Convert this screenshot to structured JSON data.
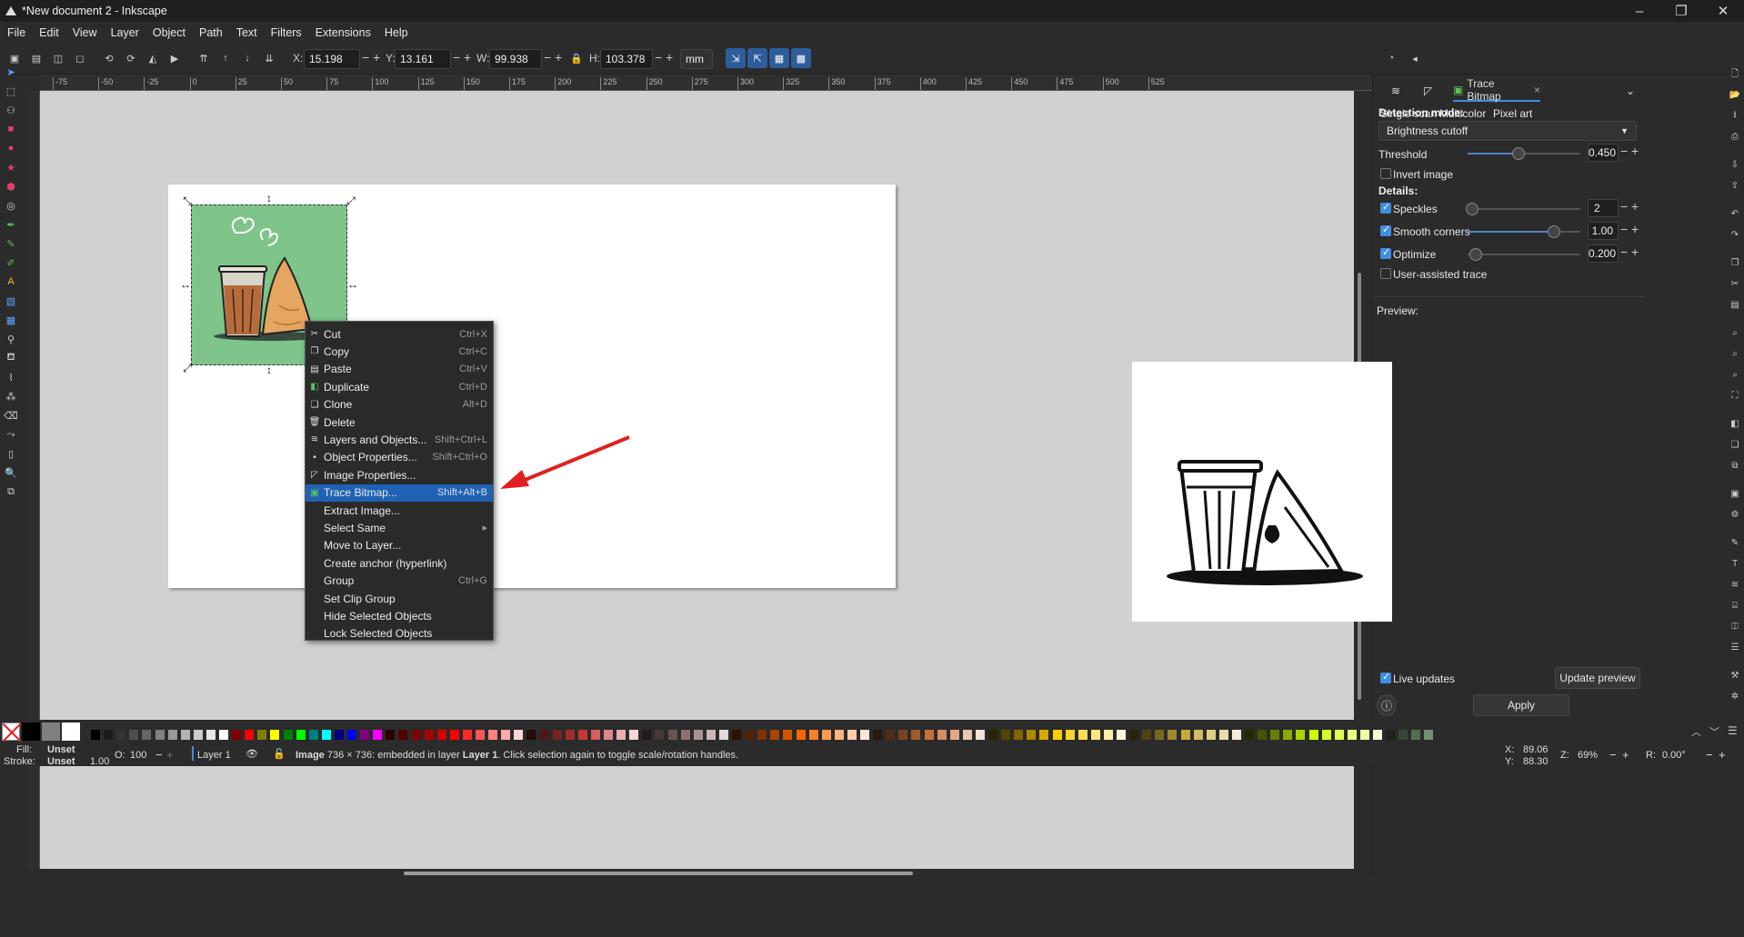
{
  "window": {
    "title": "*New document 2 - Inkscape",
    "minimize": "–",
    "maximize": "❐",
    "close": "✕"
  },
  "menu": [
    "File",
    "Edit",
    "View",
    "Layer",
    "Object",
    "Path",
    "Text",
    "Filters",
    "Extensions",
    "Help"
  ],
  "toolbar": {
    "x_label": "X:",
    "x_value": "15.198",
    "y_label": "Y:",
    "y_value": "13.161",
    "w_label": "W:",
    "w_value": "99.938",
    "h_label": "H:",
    "h_value": "103.378",
    "unit": "mm"
  },
  "ruler_ticks": [
    "-75",
    "-50",
    "-25",
    "0",
    "25",
    "50",
    "75",
    "100",
    "125",
    "150",
    "175",
    "200",
    "225",
    "250",
    "275",
    "300",
    "325",
    "350",
    "375",
    "400",
    "425",
    "450",
    "475",
    "500",
    "525"
  ],
  "context_menu": [
    {
      "icon": "scissors-icon",
      "glyph": "✂",
      "label": "Cut",
      "shortcut": "Ctrl+X"
    },
    {
      "icon": "copy-icon",
      "glyph": "❐",
      "label": "Copy",
      "shortcut": "Ctrl+C"
    },
    {
      "icon": "paste-icon",
      "glyph": "▤",
      "label": "Paste",
      "shortcut": "Ctrl+V"
    },
    {
      "icon": "duplicate-icon",
      "glyph": "◧",
      "label": "Duplicate",
      "shortcut": "Ctrl+D"
    },
    {
      "icon": "clone-icon",
      "glyph": "❏",
      "label": "Clone",
      "shortcut": "Alt+D"
    },
    {
      "icon": "trash-icon",
      "glyph": "🗑",
      "label": "Delete",
      "shortcut": ""
    },
    {
      "icon": "layers-icon",
      "glyph": "≋",
      "label": "Layers and Objects...",
      "shortcut": "Shift+Ctrl+L"
    },
    {
      "icon": "object-properties-icon",
      "glyph": "▪",
      "label": "Object Properties...",
      "shortcut": "Shift+Ctrl+O"
    },
    {
      "icon": "image-properties-icon",
      "glyph": "◸",
      "label": "Image Properties...",
      "shortcut": ""
    },
    {
      "icon": "trace-bitmap-icon",
      "glyph": "▣",
      "label": "Trace Bitmap...",
      "shortcut": "Shift+Alt+B"
    },
    {
      "icon": "",
      "glyph": "",
      "label": "Extract Image...",
      "shortcut": ""
    },
    {
      "icon": "",
      "glyph": "",
      "label": "Select Same",
      "shortcut": "▸"
    },
    {
      "icon": "",
      "glyph": "",
      "label": "Move to Layer...",
      "shortcut": ""
    },
    {
      "icon": "",
      "glyph": "",
      "label": "Create anchor (hyperlink)",
      "shortcut": ""
    },
    {
      "icon": "",
      "glyph": "",
      "label": "Group",
      "shortcut": "Ctrl+G"
    },
    {
      "icon": "",
      "glyph": "",
      "label": "Set Clip Group",
      "shortcut": ""
    },
    {
      "icon": "",
      "glyph": "",
      "label": "Hide Selected Objects",
      "shortcut": ""
    },
    {
      "icon": "",
      "glyph": "",
      "label": "Lock Selected Objects",
      "shortcut": ""
    }
  ],
  "panel": {
    "tab_label": "Trace Bitmap",
    "tab_close": "×",
    "subtabs": [
      "Single scan",
      "Multicolor",
      "Pixel art"
    ],
    "detection_mode_label": "Detection mode:",
    "detection_mode_value": "Brightness cutoff",
    "threshold_label": "Threshold",
    "threshold_value": "0.450",
    "threshold_level": 0.45,
    "invert_label": "Invert image",
    "invert_checked": false,
    "details_label": "Details:",
    "speckles_label": "Speckles",
    "speckles_value": "2",
    "speckles_checked": true,
    "smooth_label": "Smooth corners",
    "smooth_value": "1.00",
    "smooth_checked": true,
    "optimize_label": "Optimize",
    "optimize_value": "0.200",
    "optimize_checked": true,
    "user_assisted_label": "User-assisted trace",
    "user_assisted_checked": false,
    "preview_label": "Preview:",
    "live_updates_label": "Live updates",
    "live_updates_checked": true,
    "update_preview_label": "Update preview",
    "apply_label": "Apply"
  },
  "status": {
    "fill_label": "Fill:",
    "fill_value": "Unset",
    "stroke_label": "Stroke:",
    "stroke_value": "Unset",
    "stroke_width": "1.00",
    "opacity_label": "O:",
    "opacity_value": "100",
    "layer_value": "Layer 1",
    "message_bold": "Image",
    "message": "736 × 736: embedded in layer",
    "message_layer": "Layer 1",
    "message_tail": ". Click selection again to toggle scale/rotation handles.",
    "x_label": "X:",
    "x_value": "89.06",
    "y_label": "Y:",
    "y_value": "88.30",
    "zoom_label": "Z:",
    "zoom_value": "69%",
    "rotation_label": "R:",
    "rotation_value": "0.00°"
  },
  "colors": {
    "accent": "#1f62b3",
    "checkbox": "#3f8de4",
    "image_bg": "#7ec48b",
    "arrow": "#e02020"
  },
  "palette": [
    "#000000",
    "#1a1a1a",
    "#333333",
    "#4d4d4d",
    "#666666",
    "#808080",
    "#999999",
    "#b3b3b3",
    "#cccccc",
    "#e6e6e6",
    "#ffffff",
    "#800000",
    "#ff0000",
    "#808000",
    "#ffff00",
    "#008000",
    "#00ff00",
    "#008080",
    "#00ffff",
    "#000080",
    "#0000ff",
    "#800080",
    "#ff00ff",
    "#2b0000",
    "#550000",
    "#800000",
    "#aa0000",
    "#d40000",
    "#ff0000",
    "#ff2a2a",
    "#ff5555",
    "#ff8080",
    "#ffaaaa",
    "#ffd5d5",
    "#280b0b",
    "#501616",
    "#782121",
    "#a02c2c",
    "#c83737",
    "#d35f5f",
    "#de8787",
    "#e9afaf",
    "#f4d7d7",
    "#241c1c",
    "#483737",
    "#6c5353",
    "#916f6f",
    "#ac9393",
    "#c8b7b7",
    "#e3dbdb",
    "#2b1100",
    "#552200",
    "#803300",
    "#aa4400",
    "#d45500",
    "#ff6600",
    "#ff7f2a",
    "#ff9955",
    "#ffb380",
    "#ffccaa",
    "#ffe6d5",
    "#28170b",
    "#502d16",
    "#784421",
    "#a05a2c",
    "#c87137",
    "#d38d5f",
    "#deaa87",
    "#e9c6af",
    "#f4e3d7",
    "#2b2200",
    "#554400",
    "#806600",
    "#aa8800",
    "#d4aa00",
    "#ffcc00",
    "#ffd42a",
    "#ffdd55",
    "#ffe680",
    "#ffeeaa",
    "#fff6d5",
    "#28220b",
    "#504416",
    "#786721",
    "#a0892c",
    "#c8ab37",
    "#d3bc5f",
    "#decd87",
    "#e9ddaf",
    "#f4eed7",
    "#222b00",
    "#445500",
    "#668000",
    "#88aa00",
    "#aad400",
    "#ccff00",
    "#d4ff2a",
    "#ddff55",
    "#e5ff80",
    "#eeffaa",
    "#f6ffd5",
    "#1c241c",
    "#374837",
    "#536c53",
    "#6f916f"
  ]
}
